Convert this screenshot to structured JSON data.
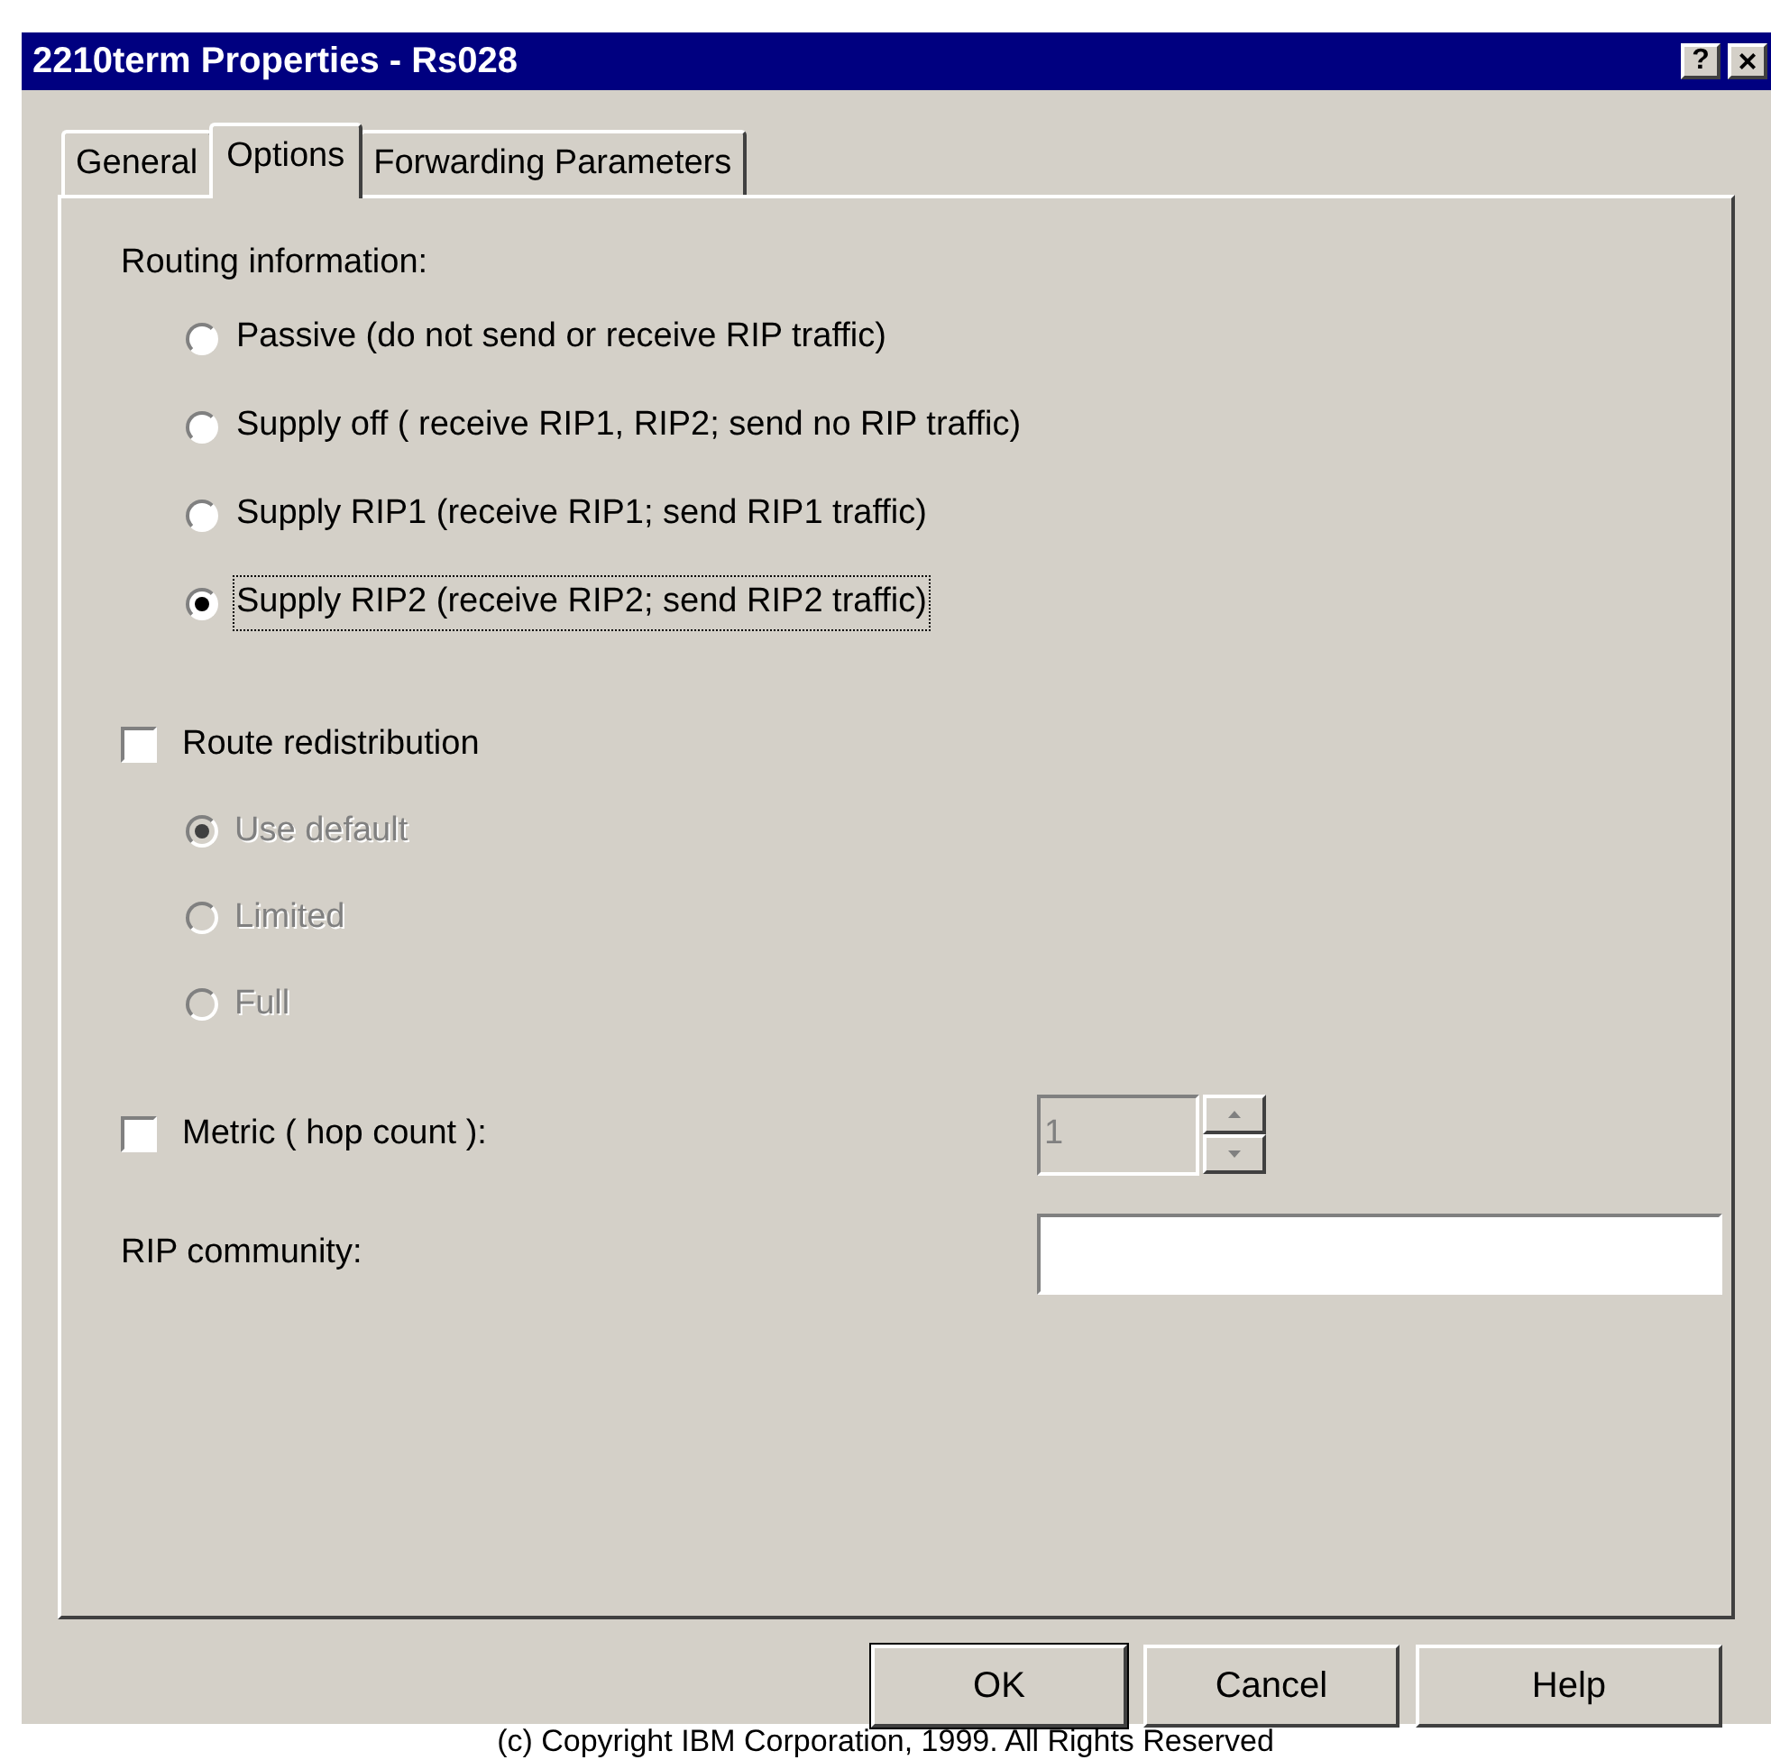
{
  "window": {
    "title": "2210term Properties - Rs028",
    "title_buttons": [
      {
        "kind": "help",
        "label": "?"
      },
      {
        "kind": "close",
        "label": "×"
      }
    ]
  },
  "tabs": [
    {
      "label": "General",
      "selected": false
    },
    {
      "label": "Options",
      "selected": true
    },
    {
      "label": "Forwarding Parameters",
      "selected": false
    }
  ],
  "routing": {
    "label": "Routing information:",
    "options": [
      {
        "label": "Passive  (do not send or receive RIP traffic)",
        "selected": false,
        "focused": false
      },
      {
        "label": "Supply off ( receive RIP1, RIP2; send no RIP traffic)",
        "selected": false,
        "focused": false
      },
      {
        "label": "Supply RIP1 (receive RIP1; send RIP1 traffic)",
        "selected": false,
        "focused": false
      },
      {
        "label": "Supply RIP2 (receive RIP2; send RIP2 traffic)",
        "selected": true,
        "focused": true
      }
    ]
  },
  "redistribution": {
    "label": "Route redistribution",
    "checked": false,
    "options": [
      {
        "label": "Use default",
        "selected": true,
        "disabled": true
      },
      {
        "label": "Limited",
        "selected": false,
        "disabled": true
      },
      {
        "label": "Full",
        "selected": false,
        "disabled": true
      }
    ]
  },
  "metric": {
    "label": "Metric ( hop count ):",
    "checked": false,
    "value": "1",
    "disabled": true
  },
  "rip_community": {
    "label": "RIP community:"
  },
  "buttons": [
    "OK",
    "Cancel",
    "Help"
  ],
  "footer": "(c) Copyright IBM Corporation, 1999. All Rights Reserved"
}
